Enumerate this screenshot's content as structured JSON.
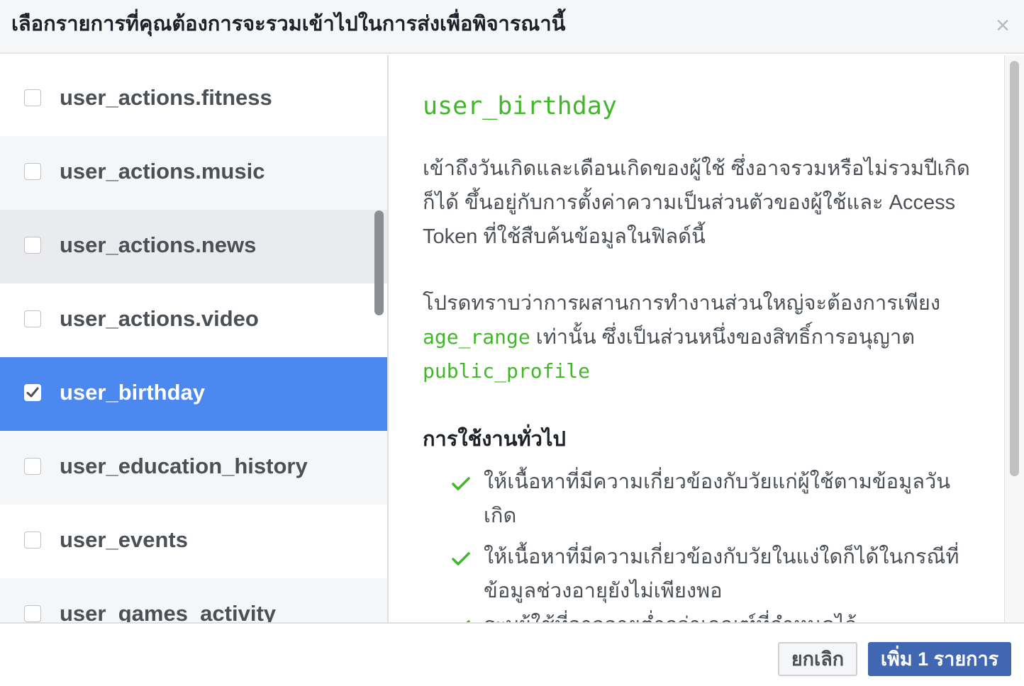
{
  "header": {
    "title": "เลือกรายการที่คุณต้องการจะรวมเข้าไปในการส่งเพื่อพิจารณานี้",
    "close_glyph": "×"
  },
  "permissions": [
    {
      "label": "user_actions.fitness",
      "checked": false
    },
    {
      "label": "user_actions.music",
      "checked": false
    },
    {
      "label": "user_actions.news",
      "checked": false
    },
    {
      "label": "user_actions.video",
      "checked": false
    },
    {
      "label": "user_birthday",
      "checked": true
    },
    {
      "label": "user_education_history",
      "checked": false
    },
    {
      "label": "user_events",
      "checked": false
    },
    {
      "label": "user_games_activity",
      "checked": false
    }
  ],
  "detail": {
    "title": "user_birthday",
    "description": "เข้าถึงวันเกิดและเดือนเกิดของผู้ใช้ ซึ่งอาจรวมหรือไม่รวมปีเกิดก็ได้ ขึ้นอยู่กับการตั้งค่าความเป็นส่วนตัวของผู้ใช้และ Access Token ที่ใช้สืบค้นข้อมูลในฟิลด์นี้",
    "note_prefix": "โปรดทราบว่าการผสานการทำงานส่วนใหญ่จะต้องการเพียง",
    "note_code1": "age_range",
    "note_middle": " เท่านั้น ซึ่งเป็นส่วนหนึ่งของสิทธิ์การอนุญาต",
    "note_code2": "public_profile",
    "uses_heading": "การใช้งานทั่วไป",
    "uses": [
      "ให้เนื้อหาที่มีความเกี่ยวข้องกับวัยแก่ผู้ใช้ตามข้อมูลวันเกิด",
      "ให้เนื้อหาที่มีความเกี่ยวข้องกับวัยในแง่ใดก็ได้ในกรณีที่ข้อมูลช่วงอายุยังไม่เพียงพอ",
      "ระบุผู้ใช้ที่อาจอายุต่ำกว่าเกณฑ์ที่กำหนดไว้"
    ]
  },
  "footer": {
    "cancel_label": "ยกเลิก",
    "confirm_label": "เพิ่ม 1 รายการ"
  },
  "colors": {
    "accent_blue": "#4b88f0",
    "primary_button": "#4267b2",
    "code_green": "#42b72a"
  }
}
